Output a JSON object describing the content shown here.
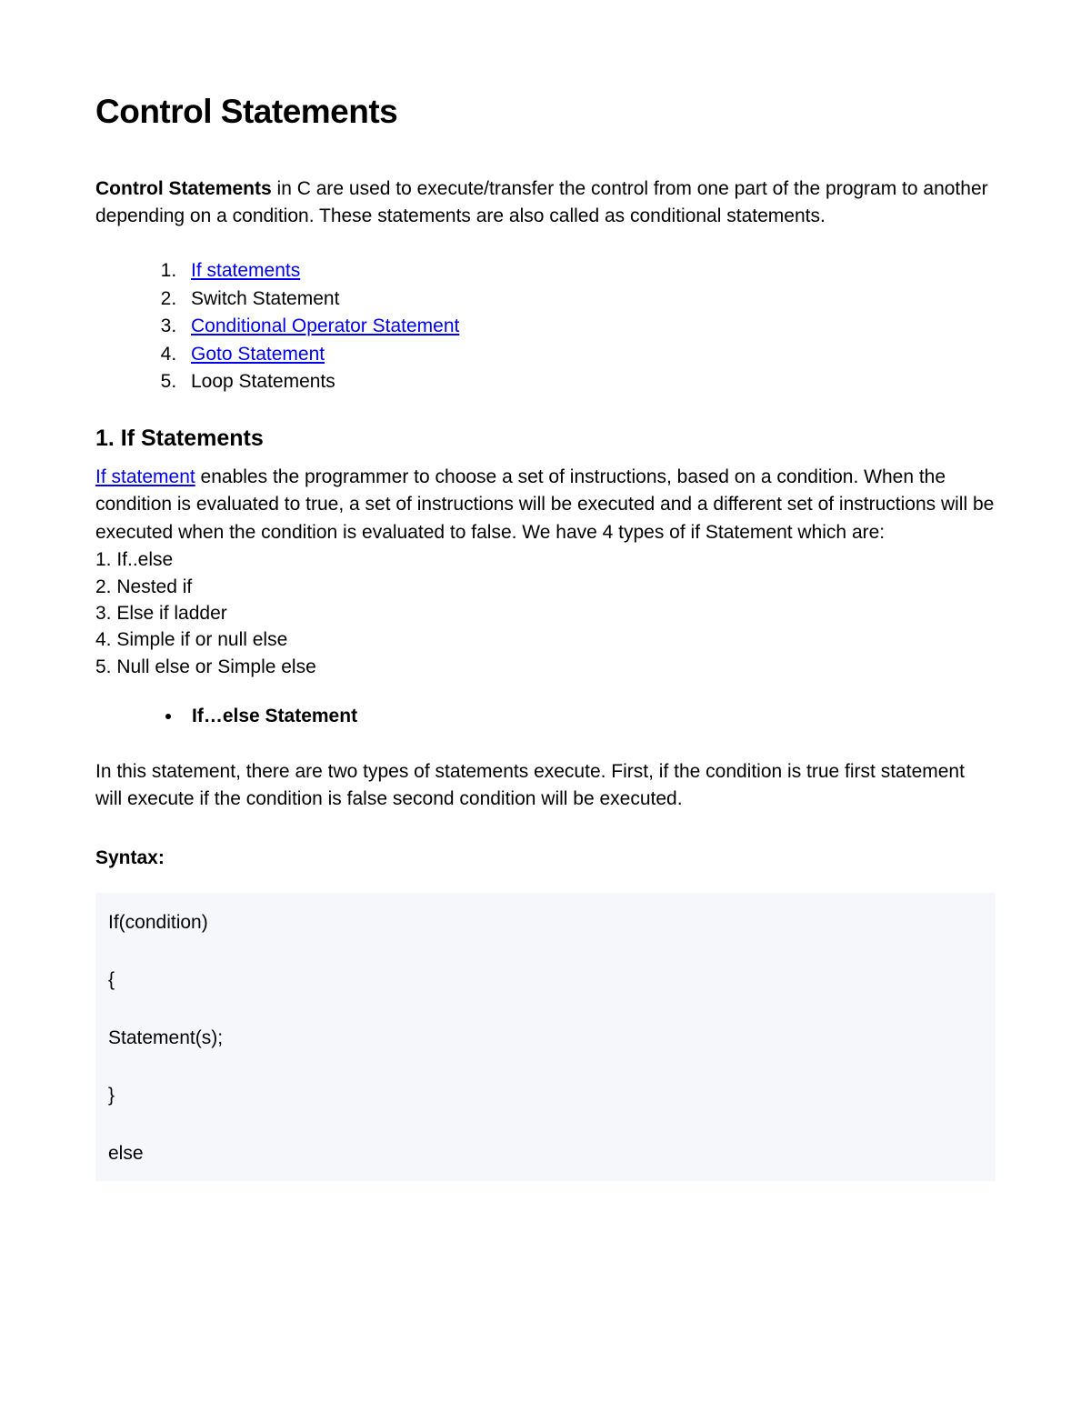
{
  "title": "Control Statements",
  "intro": {
    "bold": "Control Statements",
    "rest": " in C are used to execute/transfer the control from one part of the program to another depending on a condition. These statements are also called as conditional statements."
  },
  "toc": [
    {
      "label": "If statements",
      "link": true
    },
    {
      "label": "Switch Statement",
      "link": false
    },
    {
      "label": "Conditional Operator Statement",
      "link": true
    },
    {
      "label": "Goto Statement",
      "link": true
    },
    {
      "label": "Loop Statements",
      "link": false
    }
  ],
  "section1": {
    "heading": "1. If Statements",
    "lead_link": "If statement",
    "lead_rest": " enables the programmer to choose a set of instructions, based on a condition. When the condition is evaluated to true, a set of instructions will be executed and a different set of instructions will be executed when the condition is evaluated to false. We have 4 types of if Statement which are:",
    "types": [
      "1. If..else",
      "2. Nested if",
      "3. Else if ladder",
      "4. Simple if or null else",
      "5. Null else or Simple else"
    ],
    "sub_bullet": "If…else Statement",
    "ifelse_desc": "In this statement, there are two types of statements execute. First, if the condition is true first statement will execute if the condition is false second condition will be executed.",
    "syntax_label": "Syntax:",
    "code_lines": [
      "If(condition)",
      "{",
      "Statement(s);",
      "}",
      "else"
    ]
  }
}
